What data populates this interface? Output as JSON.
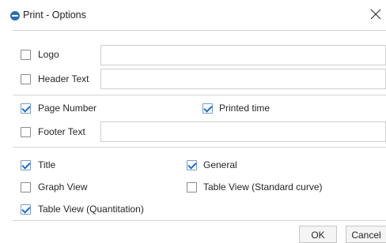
{
  "window": {
    "title": "Print - Options",
    "close_icon": "close-icon",
    "app_icon": "app-icon"
  },
  "header_section": {
    "logo": {
      "label": "Logo",
      "checked": false,
      "value": ""
    },
    "header_text": {
      "label": "Header Text",
      "checked": false,
      "value": ""
    }
  },
  "footer_section": {
    "page_number": {
      "label": "Page Number",
      "checked": true
    },
    "printed_time": {
      "label": "Printed time",
      "checked": true
    },
    "footer_text": {
      "label": "Footer Text",
      "checked": false,
      "value": ""
    }
  },
  "content_section": {
    "title": {
      "label": "Title",
      "checked": true
    },
    "general": {
      "label": "General",
      "checked": true
    },
    "graph_view": {
      "label": "Graph View",
      "checked": false
    },
    "table_view_standard": {
      "label": "Table View (Standard curve)",
      "checked": false
    },
    "table_view_quant": {
      "label": "Table View (Quantitation)",
      "checked": true
    }
  },
  "buttons": {
    "ok": "OK",
    "cancel": "Cancel"
  },
  "colors": {
    "check_accent": "#1e6fcc",
    "separator": "#d5d5d5"
  }
}
